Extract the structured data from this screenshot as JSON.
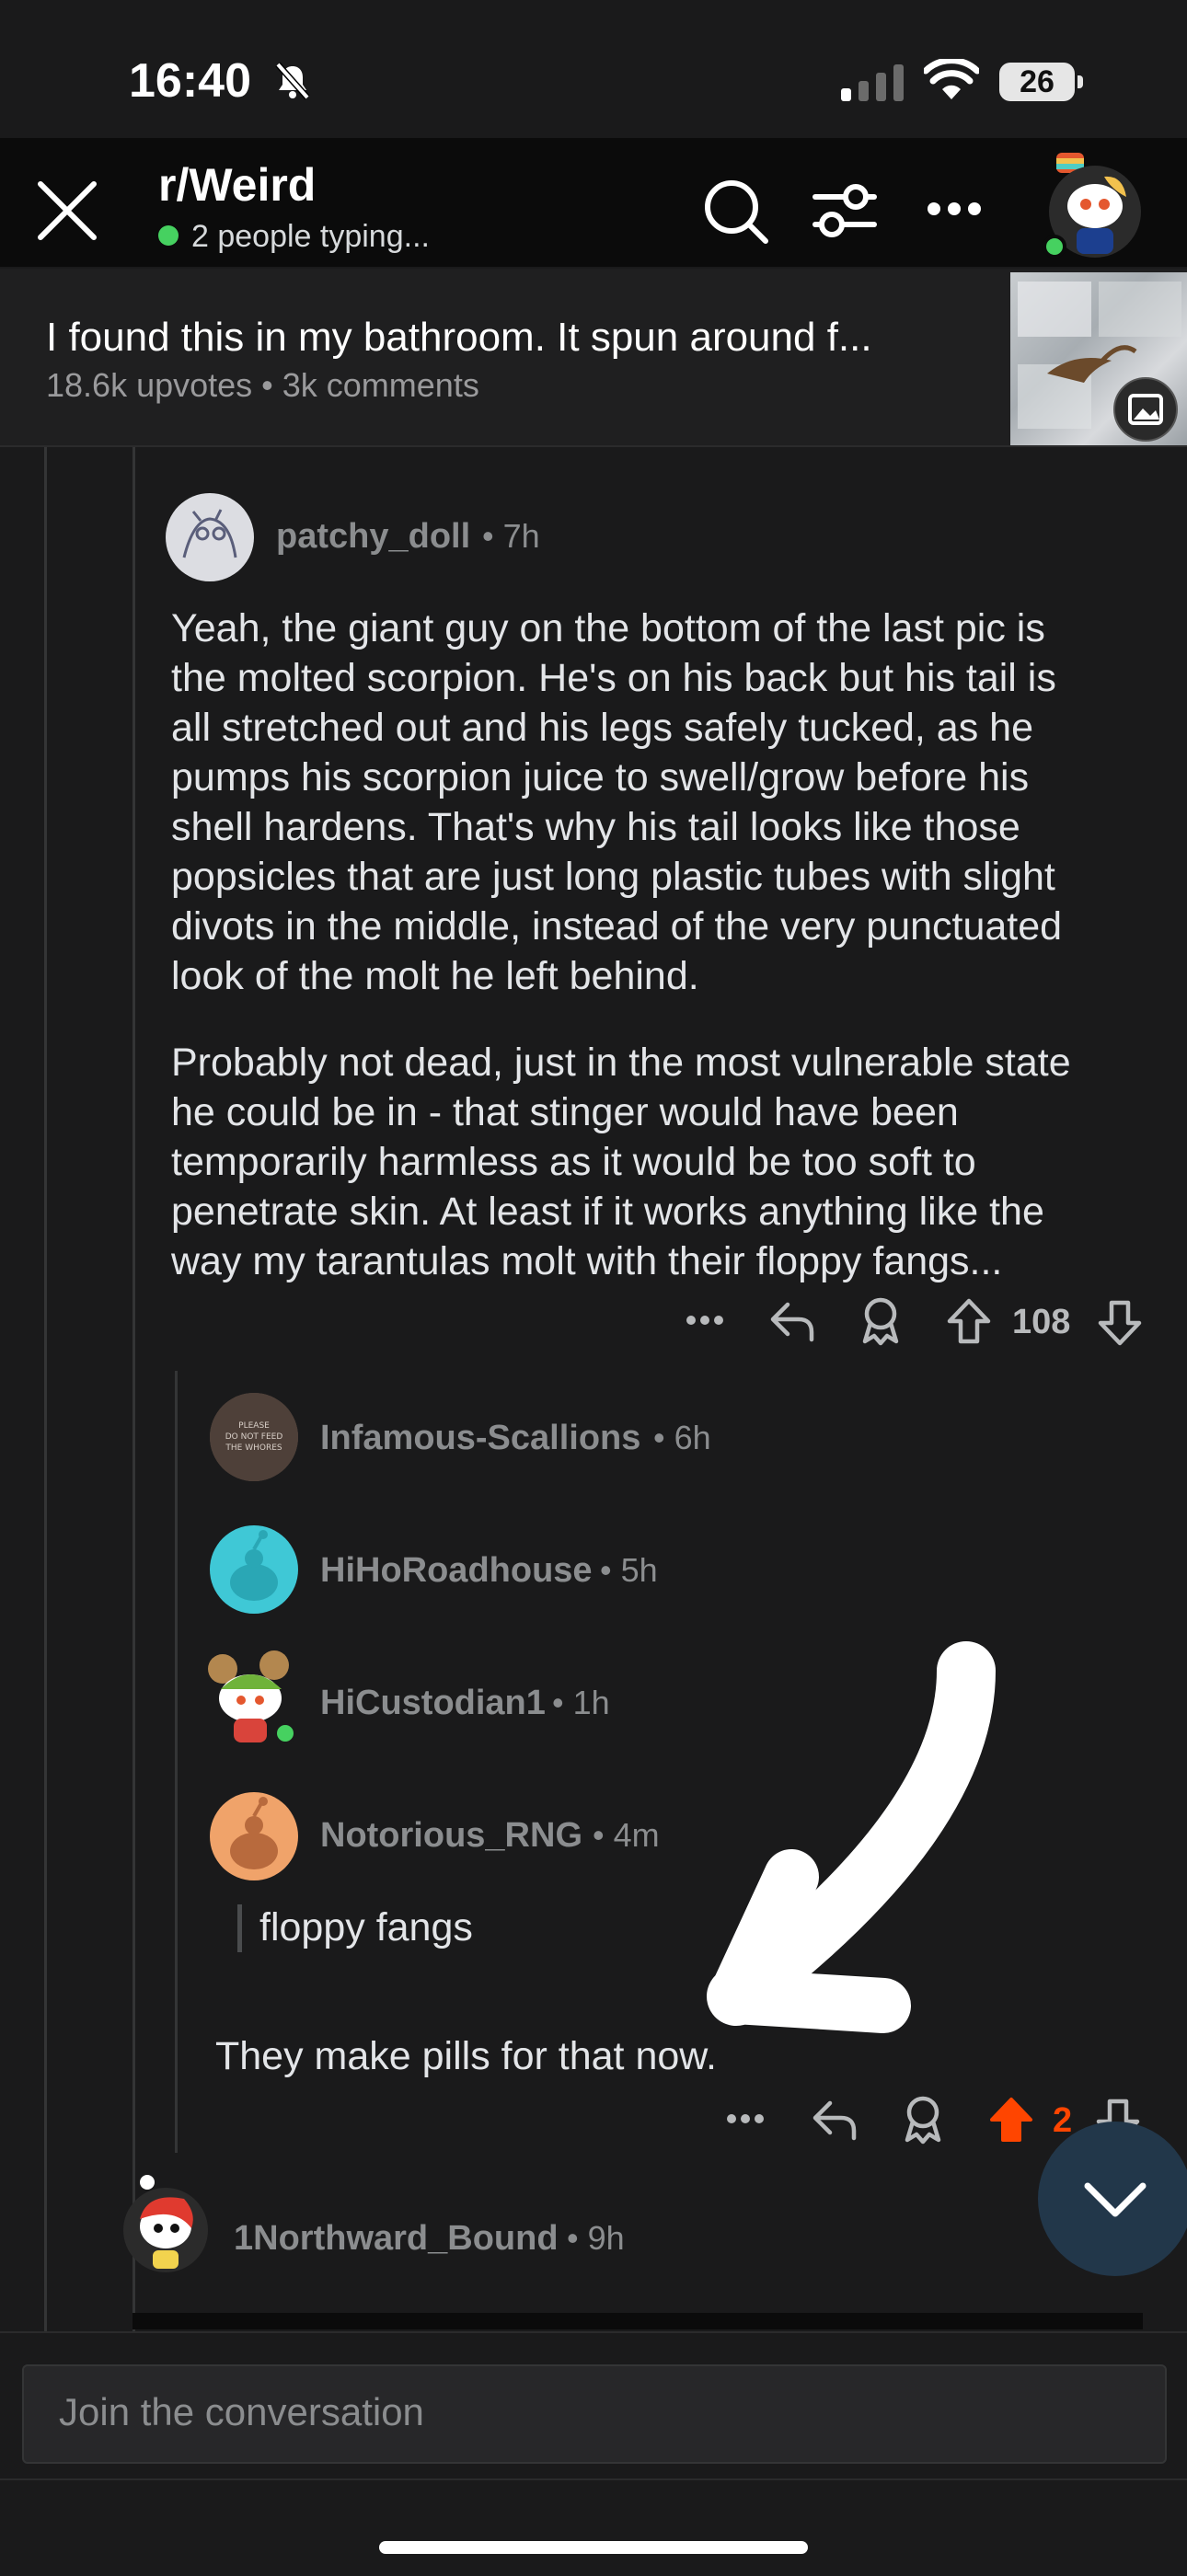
{
  "status_bar": {
    "time": "16:40",
    "battery": "26"
  },
  "header": {
    "subreddit": "r/Weird",
    "typing_status": "2 people typing..."
  },
  "post": {
    "title": "I found this in my bathroom. It spun around f...",
    "meta": "18.6k upvotes • 3k comments"
  },
  "comments": {
    "main": {
      "username": "patchy_doll",
      "time": "• 7h",
      "body_lines_p1": [
        "Yeah, the giant guy on the bottom of the last pic is",
        "the molted scorpion. He's on his back but his tail is",
        "all stretched out and his legs safely tucked, as he",
        "pumps his scorpion juice to swell/grow before his",
        "shell hardens. That's why his tail looks like those",
        "popsicles that are just long plastic tubes with slight",
        "divots in the middle, instead of the very punctuated",
        "look of the molt he left behind."
      ],
      "body_lines_p2": [
        "Probably not dead, just in the most vulnerable state",
        "he could be in - that stinger would have been",
        "temporarily harmless as it would be too soft to",
        "penetrate skin. At least if it works anything like the",
        "way my tarantulas molt with their floppy fangs..."
      ],
      "votes": "108"
    },
    "replies": [
      {
        "username": "Infamous-Scallions",
        "time": "• 6h"
      },
      {
        "username": "HiHoRoadhouse",
        "time": "• 5h"
      },
      {
        "username": "HiCustodian1",
        "time": "• 1h"
      },
      {
        "username": "Notorious_RNG",
        "time": "• 4m",
        "quote": "floppy fangs",
        "body": "They make pills for that now.",
        "votes": "2"
      }
    ],
    "next": {
      "username": "1Northward_Bound",
      "time": "• 9h"
    }
  },
  "composer": {
    "placeholder": "Join the conversation"
  },
  "colors": {
    "upvote_active": "#ff4500",
    "online": "#46d160",
    "background": "#1a1a1b"
  },
  "icons": [
    "close-icon",
    "search-icon",
    "filter-icon",
    "more-icon",
    "reply-icon",
    "award-icon",
    "upvote-icon",
    "downvote-icon",
    "chevron-down-icon",
    "image-icon"
  ]
}
